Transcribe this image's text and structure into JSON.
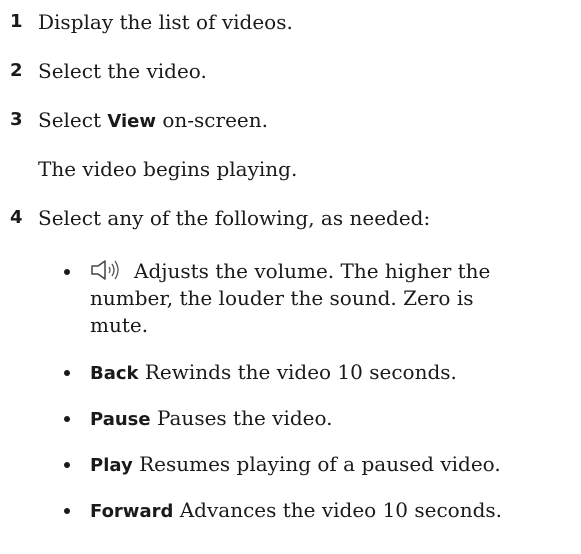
{
  "steps": [
    {
      "number": "1",
      "text": "Display the list of videos."
    },
    {
      "number": "2",
      "text": "Select the video."
    },
    {
      "number": "3",
      "text_before": "Select ",
      "ui_term": "View",
      "text_after": " on-screen."
    },
    {
      "number": "4",
      "text": "Select any of the following, as needed:"
    }
  ],
  "step3_note": "The video begins playing.",
  "options": {
    "volume": {
      "icon": "volume-speaker-icon",
      "line1": "Adjusts the volume. The higher the",
      "line2": "number, the louder the sound. Zero is",
      "line3": "mute."
    },
    "back": {
      "term": "Back",
      "description": "Rewinds the video 10 seconds."
    },
    "pause": {
      "term": "Pause",
      "description": "Pauses the video."
    },
    "play": {
      "term": "Play",
      "description": "Resumes playing of a paused video."
    },
    "forward": {
      "term": "Forward",
      "description": "Advances the video 10 seconds."
    }
  }
}
